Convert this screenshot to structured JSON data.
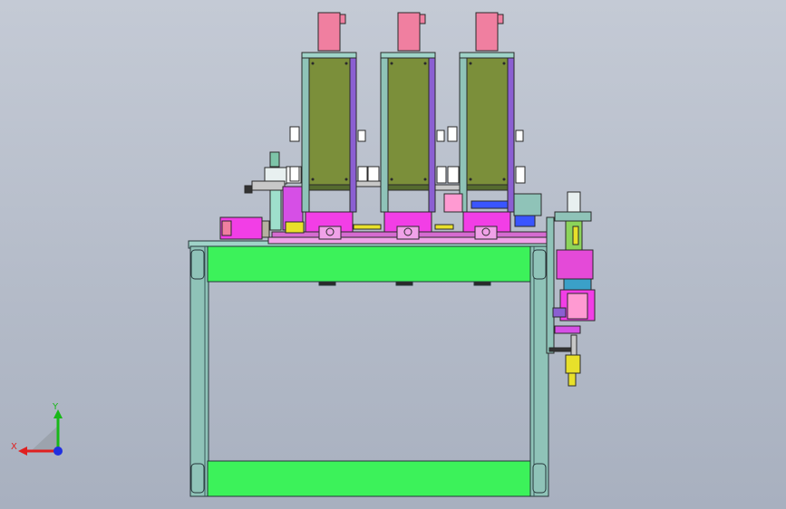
{
  "viewport": {
    "background_top": "#c3c9d4",
    "background_bottom": "#a7afbe"
  },
  "colors": {
    "frame_teal": "#8fc3b8",
    "frame_outline": "#2b3b3f",
    "panel_green": "#3cf25a",
    "module_olive": "#7b8f3a",
    "module_purple": "#8b5fd2",
    "motor_pink": "#f07fa0",
    "base_magenta": "#f23ee6",
    "plate_pink": "#f0a2e8",
    "accent_blue": "#3a55ff",
    "accent_yellow": "#e8e02a"
  },
  "triad": {
    "x_label": "X",
    "y_label": "Y",
    "x_color": "#e02020",
    "y_color": "#18b818",
    "z_color": "#2030e0"
  },
  "icons": {
    "triad": "coordinate-triad-icon"
  }
}
